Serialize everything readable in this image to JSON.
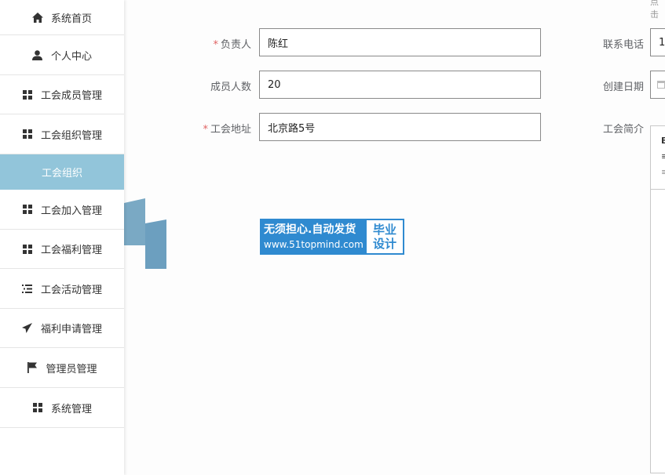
{
  "sidebar": {
    "items": [
      {
        "label": "系统首页",
        "icon": "home-icon"
      },
      {
        "label": "个人中心",
        "icon": "user-icon"
      },
      {
        "label": "工会成员管理",
        "icon": "grid-icon"
      },
      {
        "label": "工会组织管理",
        "icon": "grid-icon"
      },
      {
        "label": "工会组织",
        "icon": ""
      },
      {
        "label": "工会加入管理",
        "icon": "grid-icon"
      },
      {
        "label": "工会福利管理",
        "icon": "grid-icon"
      },
      {
        "label": "工会活动管理",
        "icon": "list-icon"
      },
      {
        "label": "福利申请管理",
        "icon": "send-icon"
      },
      {
        "label": "管理员管理",
        "icon": "flag-icon"
      },
      {
        "label": "系统管理",
        "icon": "grid-icon"
      }
    ],
    "active_color": "#92c5da"
  },
  "form": {
    "required_mark": "*",
    "leader_label": "负责人",
    "leader_value": "陈红",
    "count_label": "成员人数",
    "count_value": "20",
    "address_label": "工会地址",
    "address_value": "北京路5号",
    "phone_label": "联系电话",
    "phone_value": "1",
    "date_label": "创建日期",
    "intro_label": "工会简介"
  },
  "corner_text": "点击",
  "watermark": {
    "line1": "无须担心.自动发货",
    "line2": "www.51topmind.com",
    "right1": "毕业",
    "right2": "设计"
  }
}
